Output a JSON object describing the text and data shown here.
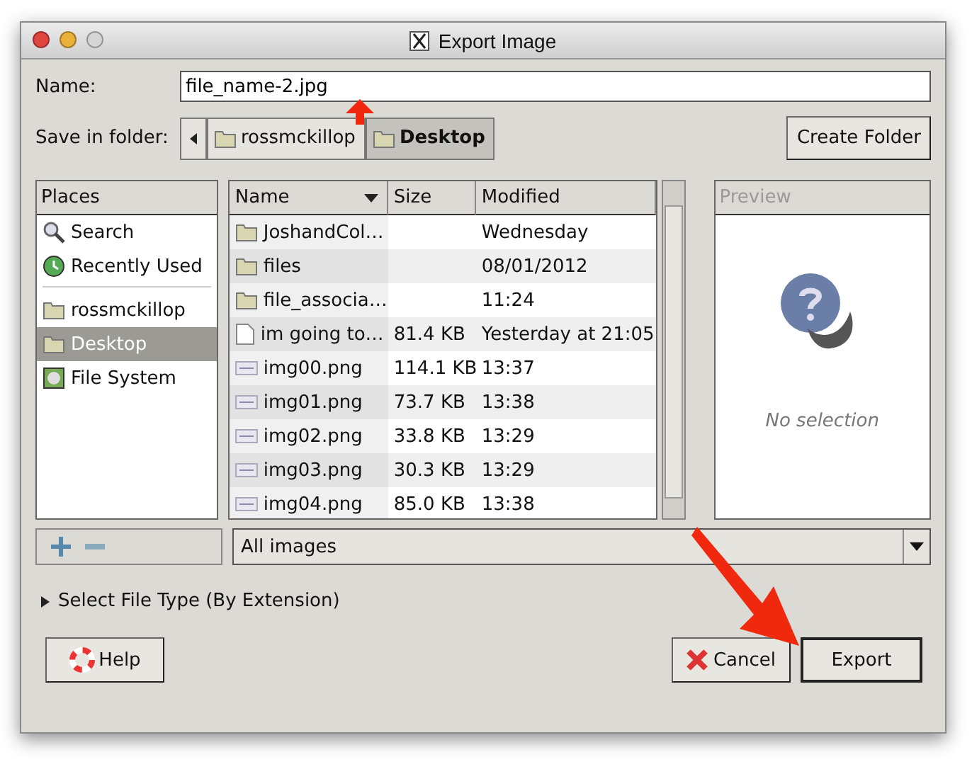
{
  "window": {
    "title": "Export Image"
  },
  "name_field": {
    "label": "Name:",
    "value": "file_name-2.jpg"
  },
  "save_in": {
    "label": "Save in folder:",
    "path": [
      {
        "label": "rossmckillop",
        "selected": false
      },
      {
        "label": "Desktop",
        "selected": true
      }
    ],
    "create_folder": "Create Folder"
  },
  "places": {
    "title": "Places",
    "items": [
      {
        "label": "Search",
        "kind": "search",
        "selected": false
      },
      {
        "label": "Recently Used",
        "kind": "recent",
        "selected": false
      },
      {
        "label": "rossmckillop",
        "kind": "folder",
        "selected": false
      },
      {
        "label": "Desktop",
        "kind": "folder",
        "selected": true
      },
      {
        "label": "File System",
        "kind": "drive",
        "selected": false
      }
    ]
  },
  "files": {
    "columns": [
      "Name",
      "Size",
      "Modified"
    ],
    "rows": [
      {
        "name": "JoshandCol…",
        "size": "",
        "modified": "Wednesday",
        "kind": "folder"
      },
      {
        "name": "files",
        "size": "",
        "modified": "08/01/2012",
        "kind": "folder"
      },
      {
        "name": "file_associa…",
        "size": "",
        "modified": "11:24",
        "kind": "folder"
      },
      {
        "name": "im going to…",
        "size": "81.4 KB",
        "modified": "Yesterday at 21:05",
        "kind": "document"
      },
      {
        "name": "img00.png",
        "size": "114.1 KB",
        "modified": "13:37",
        "kind": "image"
      },
      {
        "name": "img01.png",
        "size": "73.7 KB",
        "modified": "13:38",
        "kind": "image"
      },
      {
        "name": "img02.png",
        "size": "33.8 KB",
        "modified": "13:29",
        "kind": "image"
      },
      {
        "name": "img03.png",
        "size": "30.3 KB",
        "modified": "13:29",
        "kind": "image"
      },
      {
        "name": "img04.png",
        "size": "85.0 KB",
        "modified": "13:38",
        "kind": "image"
      }
    ]
  },
  "preview": {
    "title": "Preview",
    "message": "No selection"
  },
  "filter": {
    "value": "All images"
  },
  "expander": {
    "label": "Select File Type (By Extension)",
    "expanded": false
  },
  "buttons": {
    "help": "Help",
    "cancel": "Cancel",
    "export": "Export"
  }
}
